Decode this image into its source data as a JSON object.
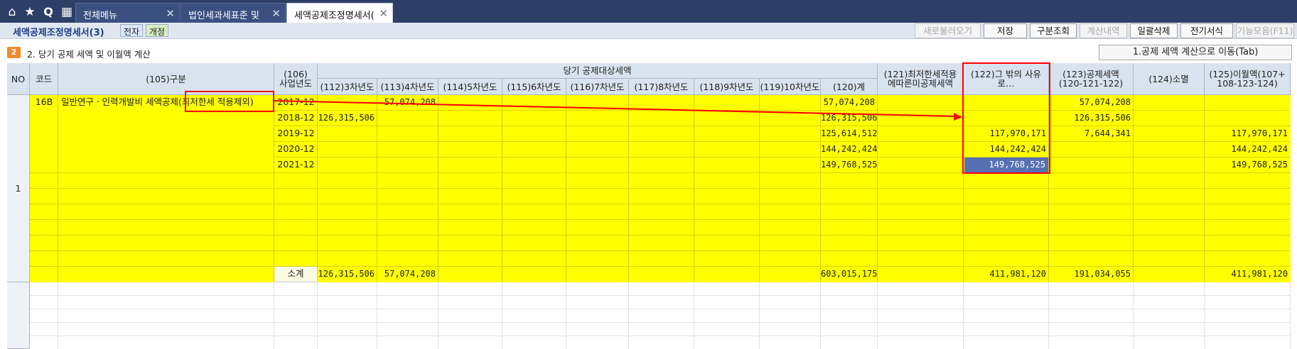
{
  "nav": {
    "home_icon": "⌂",
    "star_icon": "★",
    "search_icon": "Q",
    "apps_icon": "▦"
  },
  "tabs": [
    {
      "label": "전체메뉴",
      "close": "✕"
    },
    {
      "label": "법인세과세표준 및",
      "close": "✕"
    },
    {
      "label": "세액공제조정명세서(",
      "close": "✕"
    }
  ],
  "form": {
    "title": "세액공제조정명세서(3)",
    "tag_e": "전자",
    "tag_rev": "개정",
    "toolbar": [
      "새로불러오기",
      "저장",
      "구분조회",
      "계산내역",
      "일괄삭제",
      "전기서식",
      "기능모음(F11)"
    ],
    "toolbar_disabled": [
      true,
      false,
      false,
      true,
      false,
      false,
      true
    ]
  },
  "section": {
    "badge": "2",
    "title": "2. 당기 공제 세액 및 이월액 계산",
    "move_button": "1.공제 세액 계산으로 이동(Tab)"
  },
  "headers": {
    "no": "NO",
    "code": "코드",
    "category": "(105)구분",
    "year": "(106)\n사업년도",
    "group": "당기 공제대상세액",
    "sub": [
      "(112)3차년도",
      "(113)4차년도",
      "(114)5차년도",
      "(115)6차년도",
      "(116)7차년도",
      "(117)8차년도",
      "(118)9차년도",
      "(119)10차년도",
      "(120)계"
    ],
    "c121": "(121)최저한세적용\n에따른미공제세액",
    "c122": "(122)그 밖의 사유\n로…",
    "c123": "(123)공제세액\n(120-121-122)",
    "c124": "(124)소멸",
    "c125": "(125)이월액(107+\n108-123-124)"
  },
  "row1": {
    "no": "1",
    "code": "16B",
    "category": "일반연구ㆍ인력개발비 세액공제(최저한세 적용제외)"
  },
  "years": [
    {
      "year": "2017-12",
      "y112": "",
      "y113": "57,074,208",
      "y120": "57,074,208",
      "c122": "",
      "c123": "57,074,208",
      "c125": ""
    },
    {
      "year": "2018-12",
      "y112": "126,315,506",
      "y113": "",
      "y120": "126,315,506",
      "c122": "",
      "c123": "126,315,506",
      "c125": ""
    },
    {
      "year": "2019-12",
      "y112": "",
      "y113": "",
      "y120": "125,614,512",
      "c122": "117,970,171",
      "c123": "7,644,341",
      "c125": "117,970,171"
    },
    {
      "year": "2020-12",
      "y112": "",
      "y113": "",
      "y120": "144,242,424",
      "c122": "144,242,424",
      "c123": "",
      "c125": "144,242,424"
    },
    {
      "year": "2021-12",
      "y112": "",
      "y113": "",
      "y120": "149,768,525",
      "c122": "149,768,525",
      "c123": "",
      "c125": "149,768,525"
    }
  ],
  "subtotal": {
    "label": "소계",
    "y112": "126,315,506",
    "y113": "57,074,208",
    "y120": "603,015,175",
    "c122": "411,981,120",
    "c123": "191,034,055",
    "c125": "411,981,120"
  },
  "colors": {
    "highlight": "#ffff00",
    "selected": "#5670b4",
    "annotation": "#ff0000",
    "header": "#d9e3ef"
  }
}
